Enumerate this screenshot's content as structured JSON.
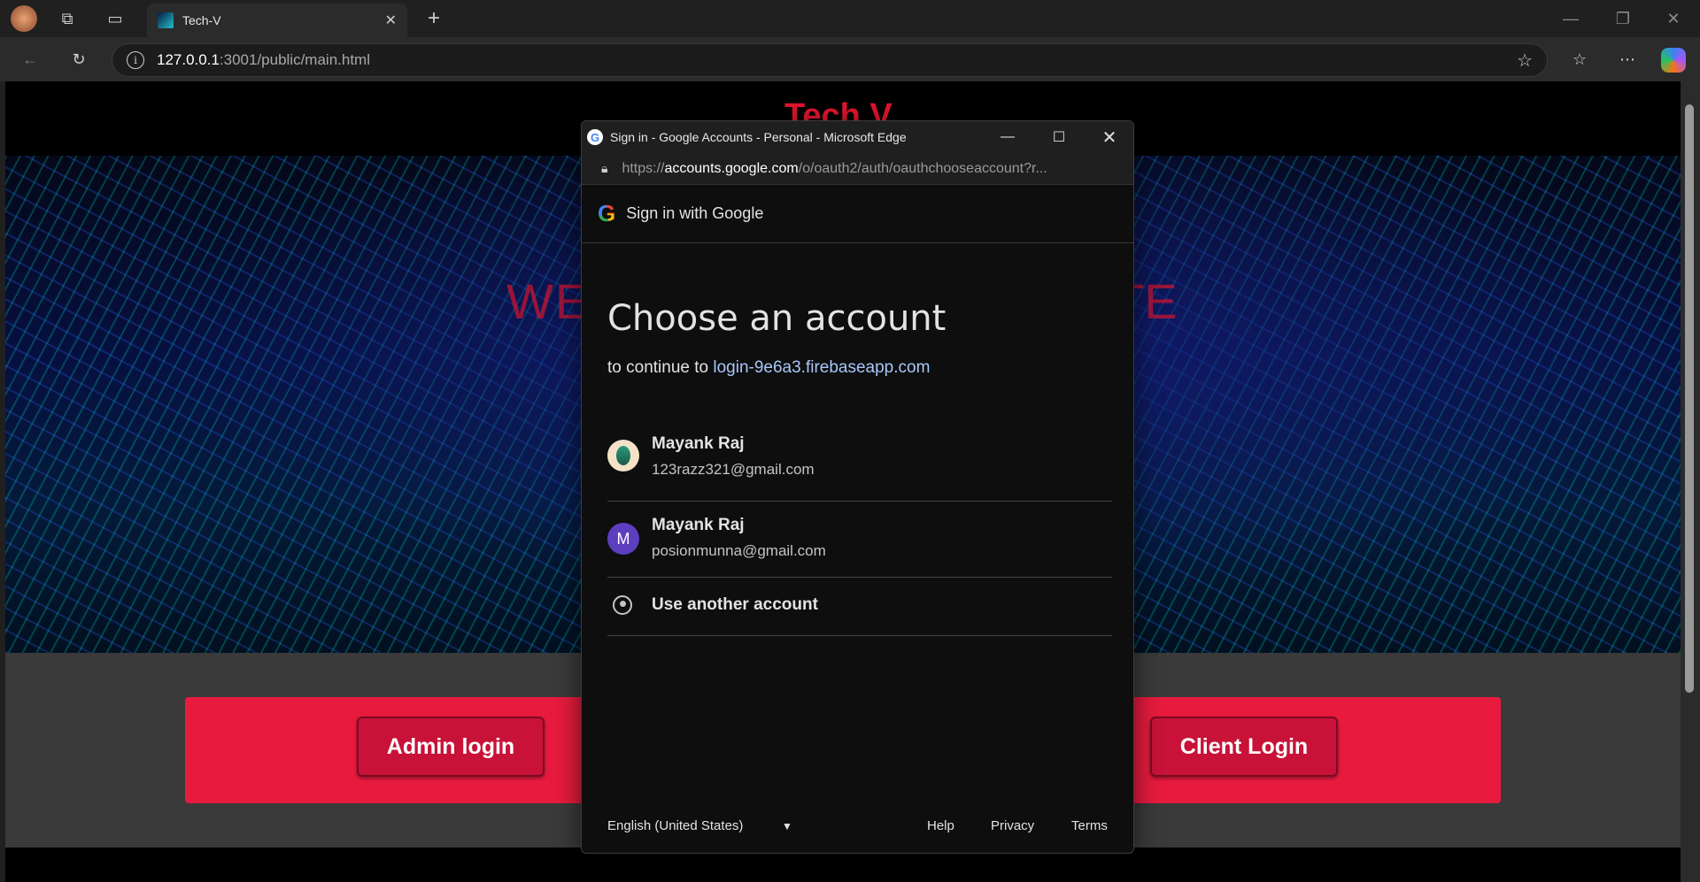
{
  "browser": {
    "tab_title": "Tech-V",
    "url_host": "127.0.0.1",
    "url_path": ":3001/public/main.html"
  },
  "page": {
    "site_title": "Tech V",
    "hero_text_left": "WE",
    "hero_text_right": "TE",
    "admin_button": "Admin login",
    "client_button": "Client Login"
  },
  "popup": {
    "window_title": "Sign in - Google Accounts - Personal - Microsoft Edge",
    "url_proto": "https://",
    "url_domain": "accounts.google.com",
    "url_rest": "/o/oauth2/auth/oauthchooseaccount?r...",
    "header_label": "Sign in with Google",
    "heading": "Choose an account",
    "continue_prefix": "to continue to",
    "continue_link": "login-9e6a3.firebaseapp.com",
    "accounts": [
      {
        "name": "Mayank Raj",
        "email": "123razz321@gmail.com"
      },
      {
        "name": "Mayank Raj",
        "email": "posionmunna@gmail.com",
        "initial": "M"
      }
    ],
    "another": "Use another account",
    "language": "English (United States)",
    "help": "Help",
    "privacy": "Privacy",
    "terms": "Terms"
  }
}
